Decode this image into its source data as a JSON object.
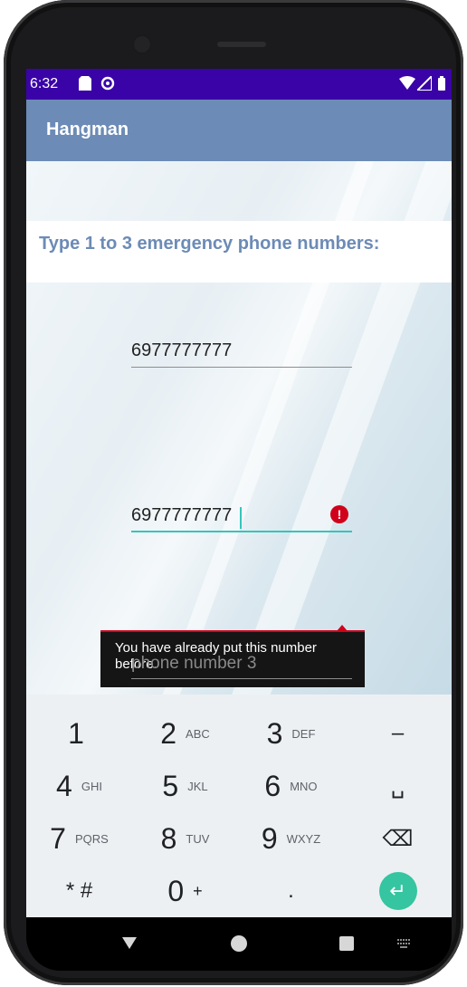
{
  "status_bar": {
    "time": "6:32"
  },
  "app_bar": {
    "title": "Hangman"
  },
  "prompt": "Type 1 to 3 emergency phone numbers:",
  "fields": {
    "phone1": {
      "value": "6977777777"
    },
    "phone2": {
      "value": "6977777777",
      "error": "You have already put this number before."
    },
    "phone3": {
      "placeholder": "phone number 3"
    }
  },
  "keyboard": {
    "rows": [
      [
        {
          "d": "1",
          "l": ""
        },
        {
          "d": "2",
          "l": "ABC"
        },
        {
          "d": "3",
          "l": "DEF"
        },
        {
          "d": "–",
          "l": ""
        }
      ],
      [
        {
          "d": "4",
          "l": "GHI"
        },
        {
          "d": "5",
          "l": "JKL"
        },
        {
          "d": "6",
          "l": "MNO"
        },
        {
          "d": "␣",
          "l": ""
        }
      ],
      [
        {
          "d": "7",
          "l": "PQRS"
        },
        {
          "d": "8",
          "l": "TUV"
        },
        {
          "d": "9",
          "l": "WXYZ"
        },
        {
          "d": "⌫",
          "l": ""
        }
      ],
      [
        {
          "d": "* #",
          "l": ""
        },
        {
          "d": "0",
          "l": "+"
        },
        {
          "d": ".",
          "l": ""
        },
        {
          "d": "↵",
          "l": ""
        }
      ]
    ]
  },
  "colors": {
    "status_bar": "#3a03a7",
    "app_bar": "#6c8bb6",
    "accent": "#35c5bb",
    "error": "#d0021b"
  }
}
